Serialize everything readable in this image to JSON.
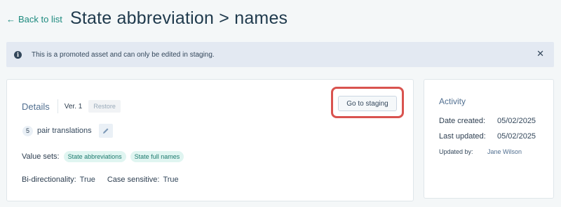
{
  "header": {
    "back_label": "Back to list",
    "title": "State abbreviation > names"
  },
  "banner": {
    "message": "This is a promoted asset and can only be edited in staging."
  },
  "details": {
    "title": "Details",
    "version": "Ver. 1",
    "restore_label": "Restore",
    "goto_staging_label": "Go to staging",
    "pair_count": "5",
    "pair_label": "pair translations",
    "value_sets_label": "Value sets:",
    "value_sets": [
      "State abbreviations",
      "State full names"
    ],
    "bidirectionality_label": "Bi-directionality:",
    "bidirectionality_value": "True",
    "case_sensitive_label": "Case sensitive:",
    "case_sensitive_value": "True"
  },
  "activity": {
    "title": "Activity",
    "date_created_label": "Date created:",
    "date_created_value": "05/02/2025",
    "last_updated_label": "Last updated:",
    "last_updated_value": "05/02/2025",
    "updated_by_label": "Updated by:",
    "updated_by_value": "Jane Wilson"
  },
  "colors": {
    "accent": "#1d8a7e",
    "highlight": "#d9534f",
    "banner_bg": "#e3e9f2"
  },
  "icons": [
    "arrow-left-icon",
    "info-icon",
    "close-icon",
    "pencil-icon"
  ]
}
